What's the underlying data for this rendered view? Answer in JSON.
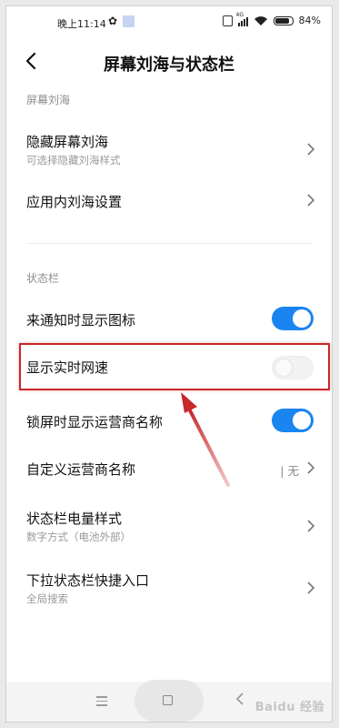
{
  "status_bar": {
    "time": "晚上11:14",
    "network_tag": "4G",
    "battery": "84%"
  },
  "header": {
    "title": "屏幕刘海与状态栏"
  },
  "sections": {
    "notch": {
      "label": "屏幕刘海"
    },
    "statusbar": {
      "label": "状态栏"
    }
  },
  "rows": {
    "hide_notch": {
      "title": "隐藏屏幕刘海",
      "subtitle": "可选择隐藏刘海样式"
    },
    "in_app_notch": {
      "title": "应用内刘海设置"
    },
    "notify_icons": {
      "title": "来通知时显示图标",
      "on": true
    },
    "net_speed": {
      "title": "显示实时网速",
      "on": false
    },
    "carrier_lock": {
      "title": "锁屏时显示运营商名称",
      "on": true
    },
    "carrier_custom": {
      "title": "自定义运营商名称",
      "value": "无"
    },
    "battery_style": {
      "title": "状态栏电量样式",
      "subtitle": "数字方式（电池外部）"
    },
    "pulldown": {
      "title": "下拉状态栏快捷入口",
      "subtitle": "全局搜索"
    }
  },
  "watermark": "Baidu 经验",
  "colors": {
    "accent": "#1a85f0",
    "highlight": "#c8282a"
  }
}
